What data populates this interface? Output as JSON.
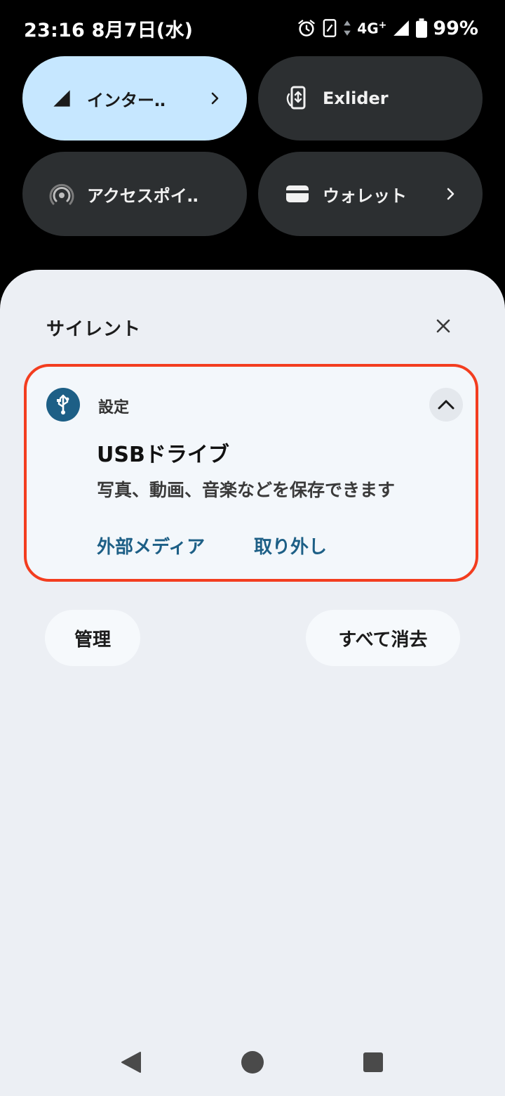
{
  "status_bar": {
    "time": "23:16",
    "date": "8月7日(水)",
    "network": "4G",
    "network_plus": "+",
    "battery": "99%"
  },
  "quick_tiles": [
    {
      "label": "インター‥",
      "icon": "cell-signal-icon",
      "state": "on",
      "has_chevron": true
    },
    {
      "label": "Exlider",
      "icon": "phone-rotate-icon",
      "state": "off",
      "has_chevron": false
    },
    {
      "label": "アクセスポイ‥",
      "icon": "hotspot-icon",
      "state": "off",
      "has_chevron": false
    },
    {
      "label": "ウォレット",
      "icon": "wallet-icon",
      "state": "off",
      "has_chevron": true
    }
  ],
  "shade": {
    "section_title": "サイレント",
    "notification": {
      "app_name": "設定",
      "app_icon": "usb-icon",
      "title": "USBドライブ",
      "text": "写真、動画、音楽などを保存できます",
      "actions": [
        "外部メディア",
        "取り外し"
      ]
    },
    "manage_label": "管理",
    "clear_all_label": "すべて消去"
  },
  "colors": {
    "accent": "#1d5f86",
    "tile_active": "#c6e7ff",
    "tile_inactive": "#2c2f31",
    "highlight_border": "#f33d1f",
    "shade_bg": "#eceff4"
  }
}
